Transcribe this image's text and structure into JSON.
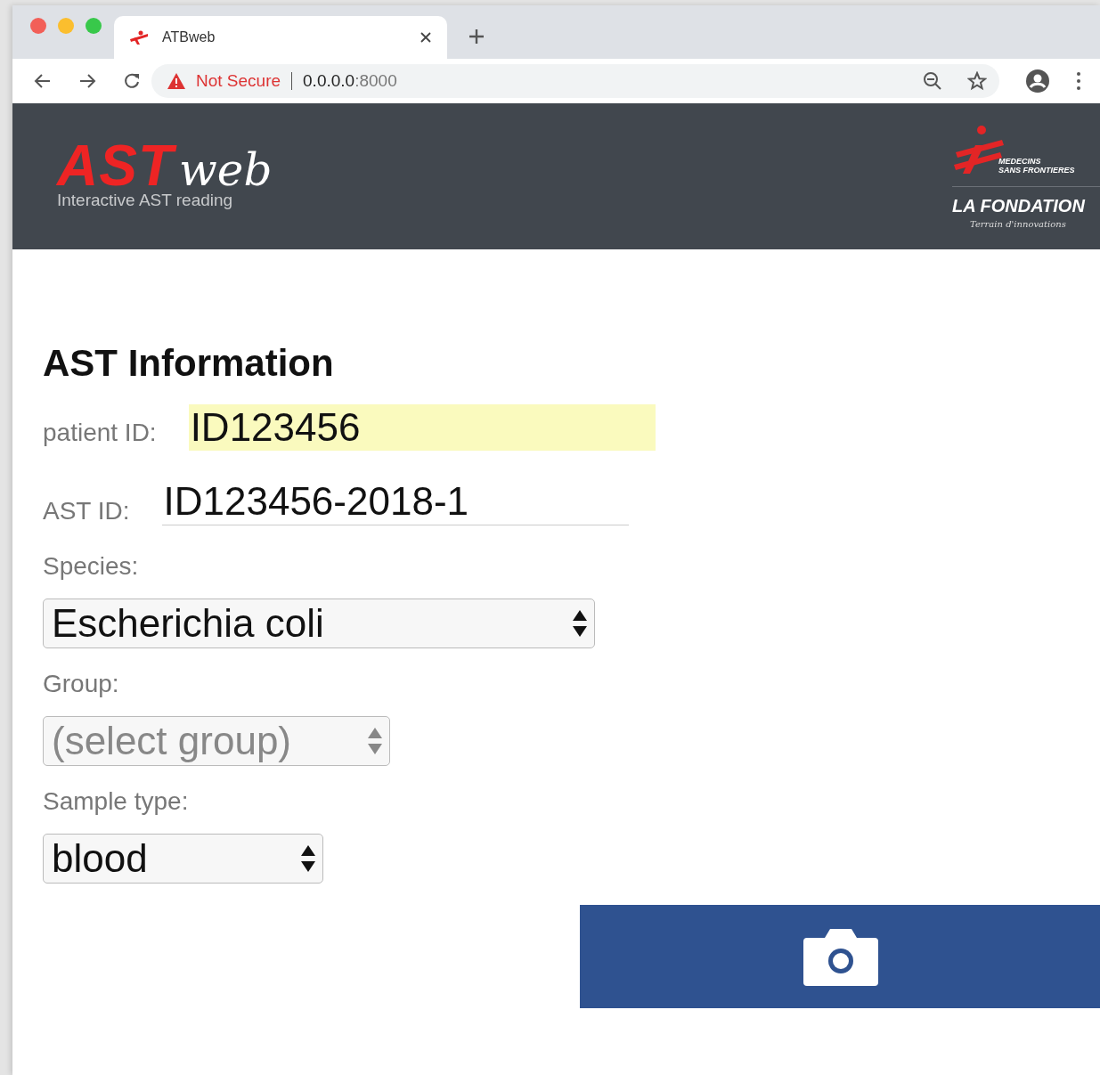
{
  "browser": {
    "tab": {
      "title": "ATBweb"
    },
    "address": {
      "security": "Not Secure",
      "host": "0.0.0.0",
      "port": ":8000"
    }
  },
  "header": {
    "logo": {
      "main": "AST",
      "script": "web",
      "tagline": "Interactive AST reading"
    },
    "partner": {
      "line1": "MEDECINS",
      "line2": "SANS FRONTIERES",
      "name": "LA FONDATION",
      "motto": "Terrain d'innovations"
    }
  },
  "form": {
    "title": "AST Information",
    "fields": [
      {
        "kind": "highlight",
        "label": "patient ID:",
        "value": "ID123456"
      },
      {
        "kind": "underline",
        "label": "AST ID:",
        "value": "ID123456-2018-1"
      },
      {
        "kind": "select",
        "label": "Species:",
        "value": "Escherichia coli",
        "disabled": false
      },
      {
        "kind": "select",
        "label": "Group:",
        "value": "(select group)",
        "disabled": true
      },
      {
        "kind": "select",
        "label": "Sample type:",
        "value": "blood",
        "disabled": false
      }
    ]
  }
}
